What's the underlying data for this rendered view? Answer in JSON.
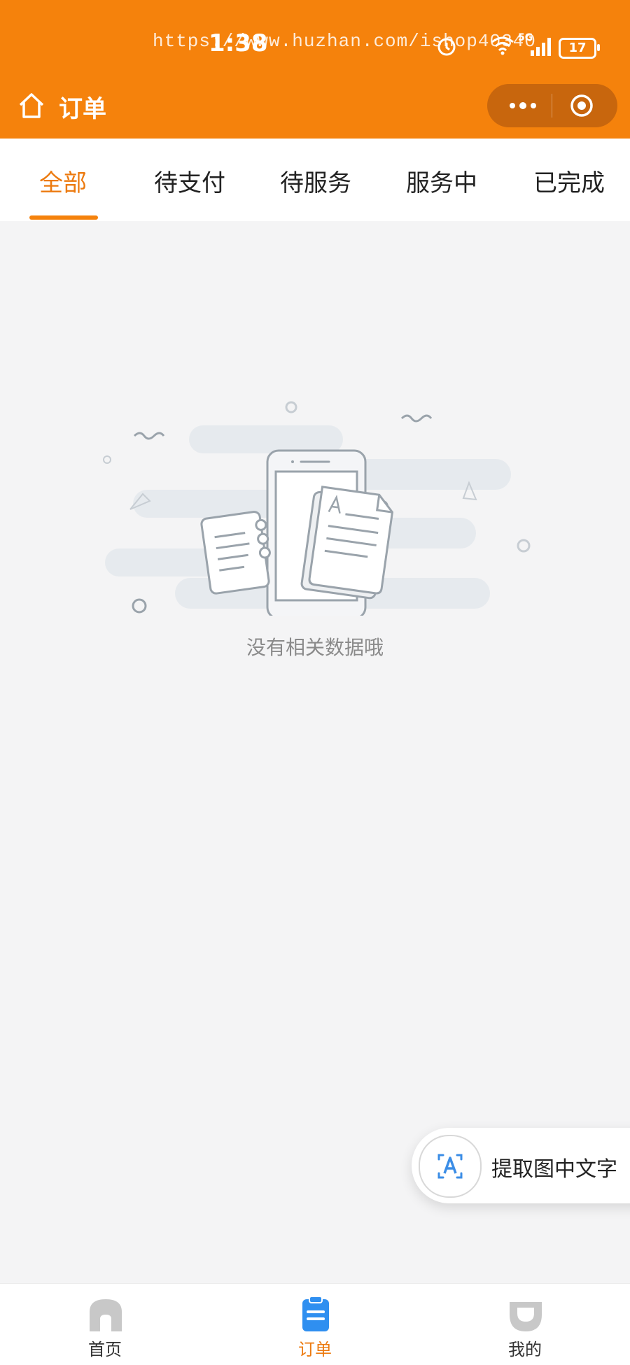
{
  "status_bar": {
    "time": "1:38",
    "watermark": "https://www.huzhan.com/ishop40340",
    "battery": "17",
    "network": "5G"
  },
  "navbar": {
    "title": "订单",
    "home_icon": "home-icon",
    "menu_icon": "more-dots-icon",
    "close_icon": "target-circle-icon"
  },
  "tabs": [
    {
      "label": "全部",
      "active": true
    },
    {
      "label": "待支付",
      "active": false
    },
    {
      "label": "待服务",
      "active": false
    },
    {
      "label": "服务中",
      "active": false
    },
    {
      "label": "已完成",
      "active": false
    }
  ],
  "empty_state": {
    "message": "没有相关数据哦"
  },
  "ocr_button": {
    "label": "提取图中文字",
    "icon": "text-scan-icon"
  },
  "bottom_nav": [
    {
      "label": "首页",
      "icon": "home-icon",
      "active": false
    },
    {
      "label": "订单",
      "icon": "clipboard-icon",
      "active": true
    },
    {
      "label": "我的",
      "icon": "profile-icon",
      "active": false
    }
  ],
  "colors": {
    "brand": "#f5820c",
    "capsule": "#c8660d",
    "active_text": "#ec7a0f",
    "active_nav": "#2f8ff0",
    "background": "#f4f4f5"
  }
}
